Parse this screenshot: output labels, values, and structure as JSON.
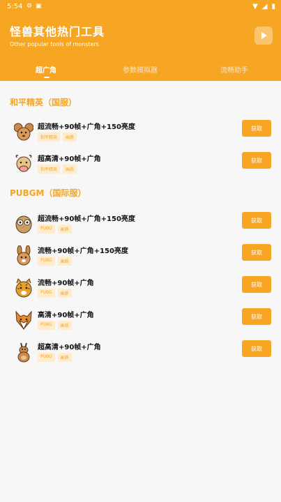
{
  "status": {
    "time": "5:54"
  },
  "header": {
    "title": "怪兽其他热门工具",
    "subtitle": "Other popular tools of monsters"
  },
  "tabs": [
    "超广角",
    "参数模拟器",
    "流畅助手"
  ],
  "sections": [
    {
      "title": "和平精英（国服）",
      "items": [
        {
          "title": "超流畅+90帧+广角+150亮度",
          "tags": [
            "和平精英",
            "画质"
          ],
          "button": "获取",
          "icon": "mouse-face-icon"
        },
        {
          "title": "超高清+90帧+广角",
          "tags": [
            "和平精英",
            "画质"
          ],
          "button": "获取",
          "icon": "cow-face-icon"
        }
      ]
    },
    {
      "title": "PUBGM（国际服）",
      "items": [
        {
          "title": "超流畅+90帧+广角+150亮度",
          "tags": [
            "PUBG",
            "画质"
          ],
          "button": "获取",
          "icon": "owl-face-icon"
        },
        {
          "title": "流畅+90帧+广角+150亮度",
          "tags": [
            "PUBG",
            "画质"
          ],
          "button": "获取",
          "icon": "rabbit-face-icon"
        },
        {
          "title": "流畅+90帧+广角",
          "tags": [
            "PUBG",
            "画质"
          ],
          "button": "获取",
          "icon": "tiger-face-icon"
        },
        {
          "title": "高清+90帧+广角",
          "tags": [
            "PUBG",
            "画质"
          ],
          "button": "获取",
          "icon": "fox-face-icon"
        },
        {
          "title": "超高清+90帧+广角",
          "tags": [
            "PUBG",
            "画质"
          ],
          "button": "获取",
          "icon": "kangaroo-icon"
        }
      ]
    }
  ],
  "colors": {
    "accent": "#f6a623",
    "tag_bg": "#fdecd0"
  }
}
